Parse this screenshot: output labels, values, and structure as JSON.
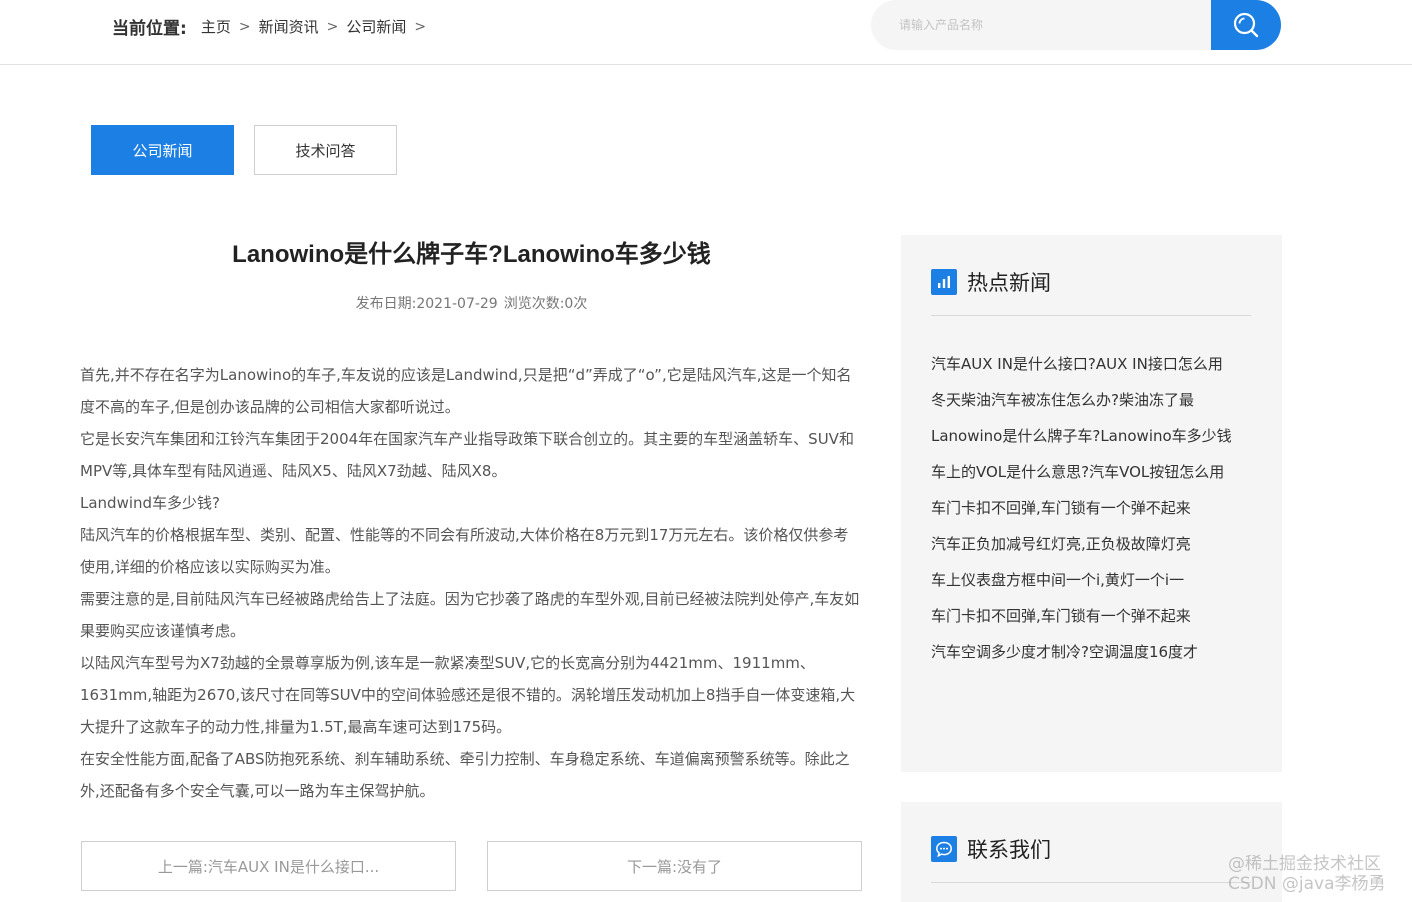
{
  "breadcrumb": {
    "label": "当前位置:",
    "items": [
      "主页",
      "新闻资讯",
      "公司新闻"
    ],
    "separator": ">"
  },
  "search": {
    "placeholder": "请输入产品名称",
    "button_icon": "search-icon"
  },
  "tabs": [
    {
      "label": "公司新闻",
      "active": true
    },
    {
      "label": "技术问答",
      "active": false
    }
  ],
  "article": {
    "title": "Lanowino是什么牌子车?Lanowino车多少钱",
    "date_label": "发布日期:2021-07-29",
    "views_label": "浏览次数:0次",
    "paragraphs": [
      "首先,并不存在名字为Lanowino的车子,车友说的应该是Landwind,只是把“d”弄成了“o”,它是陆风汽车,这是一个知名度不高的车子,但是创办该品牌的公司相信大家都听说过。",
      "它是长安汽车集团和江铃汽车集团于2004年在国家汽车产业指导政策下联合创立的。其主要的车型涵盖轿车、SUV和MPV等,具体车型有陆风逍遥、陆风X5、陆风X7劲越、陆风X8。",
      "Landwind车多少钱?",
      "陆风汽车的价格根据车型、类别、配置、性能等的不同会有所波动,大体价格在8万元到17万元左右。该价格仅供参考使用,详细的价格应该以实际购买为准。",
      "需要注意的是,目前陆风汽车已经被路虎给告上了法庭。因为它抄袭了路虎的车型外观,目前已经被法院判处停产,车友如果要购买应该谨慎考虑。",
      "以陆风汽车型号为X7劲越的全景尊享版为例,该车是一款紧凑型SUV,它的长宽高分别为4421mm、1911mm、1631mm,轴距为2670,该尺寸在同等SUV中的空间体验感还是很不错的。涡轮增压发动机加上8挡手自一体变速箱,大大提升了这款车子的动力性,排量为1.5T,最高车速可达到175码。",
      "在安全性能方面,配备了ABS防抱死系统、刹车辅助系统、牵引力控制、车身稳定系统、车道偏离预警系统等。除此之外,还配备有多个安全气囊,可以一路为车主保驾护航。"
    ],
    "prev_label": "上一篇:汽车AUX IN是什么接口...",
    "next_label": "下一篇:没有了"
  },
  "sidebar": {
    "hot_title": "热点新闻",
    "hot_items": [
      "汽车AUX IN是什么接口?AUX IN接口怎么用",
      "冬天柴油汽车被冻住怎么办?柴油冻了最",
      "Lanowino是什么牌子车?Lanowino车多少钱",
      "车上的VOL是什么意思?汽车VOL按钮怎么用",
      "车门卡扣不回弹,车门锁有一个弹不起来",
      "汽车正负加减号红灯亮,正负极故障灯亮",
      "车上仪表盘方框中间一个i,黄灯一个i一",
      "车门卡扣不回弹,车门锁有一个弹不起来",
      "汽车空调多少度才制冷?空调温度16度才"
    ],
    "contact_title": "联系我们"
  },
  "watermark": {
    "line1": "@稀土掘金技术社区",
    "line2": "CSDN @java李杨勇"
  },
  "colors": {
    "accent": "#1b7fe3",
    "sidebar_bg": "#f5f5f5"
  }
}
